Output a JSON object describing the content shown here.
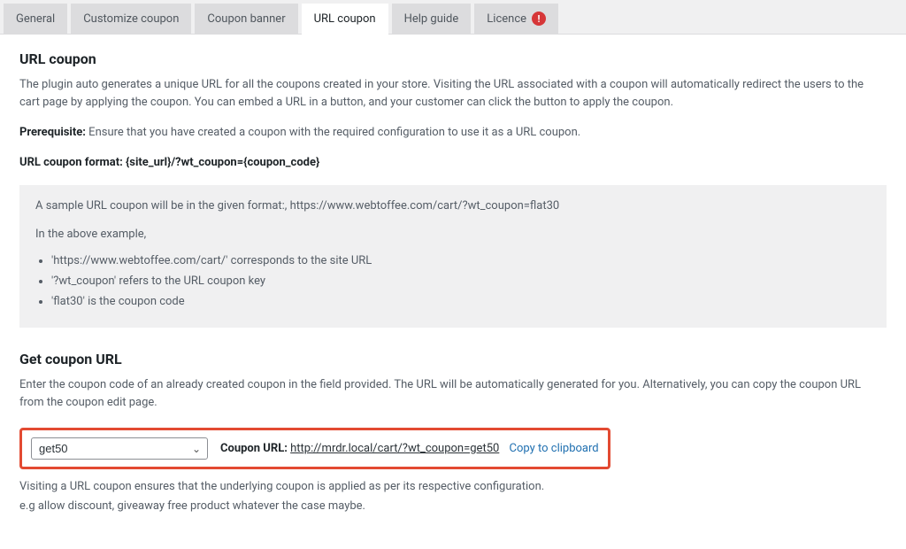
{
  "tabs": {
    "general": "General",
    "customize": "Customize coupon",
    "banner": "Coupon banner",
    "url": "URL coupon",
    "help": "Help guide",
    "licence": "Licence",
    "licence_badge": "!"
  },
  "urlcoupon": {
    "heading": "URL coupon",
    "desc": "The plugin auto generates a unique URL for all the coupons created in your store. Visiting the URL associated with a coupon will automatically redirect the users to the cart page by applying the coupon. You can embed a URL in a button, and your customer can click the button to apply the coupon.",
    "prereq_label": "Prerequisite:",
    "prereq_text": " Ensure that you have created a coupon with the required configuration to use it as a URL coupon.",
    "format_label": "URL coupon format: {site_url}/?wt_coupon={coupon_code}"
  },
  "sample": {
    "line1": "A sample URL coupon will be in the given format:, https://www.webtoffee.com/cart/?wt_coupon=flat30",
    "line2": "In the above example,",
    "b1": "'https://www.webtoffee.com/cart/' corresponds to the site URL",
    "b2": "'?wt_coupon' refers to the URL coupon key",
    "b3": "'flat30' is the coupon code"
  },
  "get": {
    "heading": "Get coupon URL",
    "desc": "Enter the coupon code of an already created coupon in the field provided. The URL will be automatically generated for you. Alternatively, you can copy the coupon URL from the coupon edit page.",
    "selected": "get50",
    "url_label": "Coupon URL:",
    "url_value": "http://mrdr.local/cart/?wt_coupon=get50",
    "copy": "Copy to clipboard",
    "note1": "Visiting a URL coupon ensures that the underlying coupon is applied as per its respective configuration.",
    "note2": "e.g allow discount, giveaway free product whatever the case maybe."
  }
}
